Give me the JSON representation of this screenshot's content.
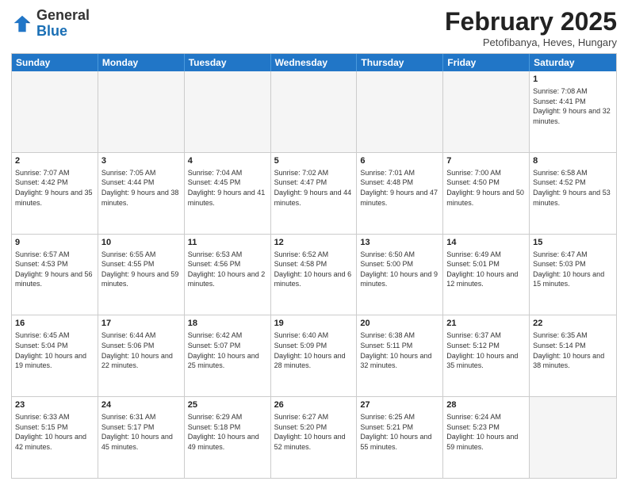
{
  "header": {
    "logo_general": "General",
    "logo_blue": "Blue",
    "month_title": "February 2025",
    "location": "Petofibanya, Heves, Hungary"
  },
  "weekdays": [
    "Sunday",
    "Monday",
    "Tuesday",
    "Wednesday",
    "Thursday",
    "Friday",
    "Saturday"
  ],
  "weeks": [
    [
      {
        "day": "",
        "empty": true,
        "info": ""
      },
      {
        "day": "",
        "empty": true,
        "info": ""
      },
      {
        "day": "",
        "empty": true,
        "info": ""
      },
      {
        "day": "",
        "empty": true,
        "info": ""
      },
      {
        "day": "",
        "empty": true,
        "info": ""
      },
      {
        "day": "",
        "empty": true,
        "info": ""
      },
      {
        "day": "1",
        "empty": false,
        "info": "Sunrise: 7:08 AM\nSunset: 4:41 PM\nDaylight: 9 hours and 32 minutes."
      }
    ],
    [
      {
        "day": "2",
        "empty": false,
        "info": "Sunrise: 7:07 AM\nSunset: 4:42 PM\nDaylight: 9 hours and 35 minutes."
      },
      {
        "day": "3",
        "empty": false,
        "info": "Sunrise: 7:05 AM\nSunset: 4:44 PM\nDaylight: 9 hours and 38 minutes."
      },
      {
        "day": "4",
        "empty": false,
        "info": "Sunrise: 7:04 AM\nSunset: 4:45 PM\nDaylight: 9 hours and 41 minutes."
      },
      {
        "day": "5",
        "empty": false,
        "info": "Sunrise: 7:02 AM\nSunset: 4:47 PM\nDaylight: 9 hours and 44 minutes."
      },
      {
        "day": "6",
        "empty": false,
        "info": "Sunrise: 7:01 AM\nSunset: 4:48 PM\nDaylight: 9 hours and 47 minutes."
      },
      {
        "day": "7",
        "empty": false,
        "info": "Sunrise: 7:00 AM\nSunset: 4:50 PM\nDaylight: 9 hours and 50 minutes."
      },
      {
        "day": "8",
        "empty": false,
        "info": "Sunrise: 6:58 AM\nSunset: 4:52 PM\nDaylight: 9 hours and 53 minutes."
      }
    ],
    [
      {
        "day": "9",
        "empty": false,
        "info": "Sunrise: 6:57 AM\nSunset: 4:53 PM\nDaylight: 9 hours and 56 minutes."
      },
      {
        "day": "10",
        "empty": false,
        "info": "Sunrise: 6:55 AM\nSunset: 4:55 PM\nDaylight: 9 hours and 59 minutes."
      },
      {
        "day": "11",
        "empty": false,
        "info": "Sunrise: 6:53 AM\nSunset: 4:56 PM\nDaylight: 10 hours and 2 minutes."
      },
      {
        "day": "12",
        "empty": false,
        "info": "Sunrise: 6:52 AM\nSunset: 4:58 PM\nDaylight: 10 hours and 6 minutes."
      },
      {
        "day": "13",
        "empty": false,
        "info": "Sunrise: 6:50 AM\nSunset: 5:00 PM\nDaylight: 10 hours and 9 minutes."
      },
      {
        "day": "14",
        "empty": false,
        "info": "Sunrise: 6:49 AM\nSunset: 5:01 PM\nDaylight: 10 hours and 12 minutes."
      },
      {
        "day": "15",
        "empty": false,
        "info": "Sunrise: 6:47 AM\nSunset: 5:03 PM\nDaylight: 10 hours and 15 minutes."
      }
    ],
    [
      {
        "day": "16",
        "empty": false,
        "info": "Sunrise: 6:45 AM\nSunset: 5:04 PM\nDaylight: 10 hours and 19 minutes."
      },
      {
        "day": "17",
        "empty": false,
        "info": "Sunrise: 6:44 AM\nSunset: 5:06 PM\nDaylight: 10 hours and 22 minutes."
      },
      {
        "day": "18",
        "empty": false,
        "info": "Sunrise: 6:42 AM\nSunset: 5:07 PM\nDaylight: 10 hours and 25 minutes."
      },
      {
        "day": "19",
        "empty": false,
        "info": "Sunrise: 6:40 AM\nSunset: 5:09 PM\nDaylight: 10 hours and 28 minutes."
      },
      {
        "day": "20",
        "empty": false,
        "info": "Sunrise: 6:38 AM\nSunset: 5:11 PM\nDaylight: 10 hours and 32 minutes."
      },
      {
        "day": "21",
        "empty": false,
        "info": "Sunrise: 6:37 AM\nSunset: 5:12 PM\nDaylight: 10 hours and 35 minutes."
      },
      {
        "day": "22",
        "empty": false,
        "info": "Sunrise: 6:35 AM\nSunset: 5:14 PM\nDaylight: 10 hours and 38 minutes."
      }
    ],
    [
      {
        "day": "23",
        "empty": false,
        "info": "Sunrise: 6:33 AM\nSunset: 5:15 PM\nDaylight: 10 hours and 42 minutes."
      },
      {
        "day": "24",
        "empty": false,
        "info": "Sunrise: 6:31 AM\nSunset: 5:17 PM\nDaylight: 10 hours and 45 minutes."
      },
      {
        "day": "25",
        "empty": false,
        "info": "Sunrise: 6:29 AM\nSunset: 5:18 PM\nDaylight: 10 hours and 49 minutes."
      },
      {
        "day": "26",
        "empty": false,
        "info": "Sunrise: 6:27 AM\nSunset: 5:20 PM\nDaylight: 10 hours and 52 minutes."
      },
      {
        "day": "27",
        "empty": false,
        "info": "Sunrise: 6:25 AM\nSunset: 5:21 PM\nDaylight: 10 hours and 55 minutes."
      },
      {
        "day": "28",
        "empty": false,
        "info": "Sunrise: 6:24 AM\nSunset: 5:23 PM\nDaylight: 10 hours and 59 minutes."
      },
      {
        "day": "",
        "empty": true,
        "info": ""
      }
    ]
  ]
}
